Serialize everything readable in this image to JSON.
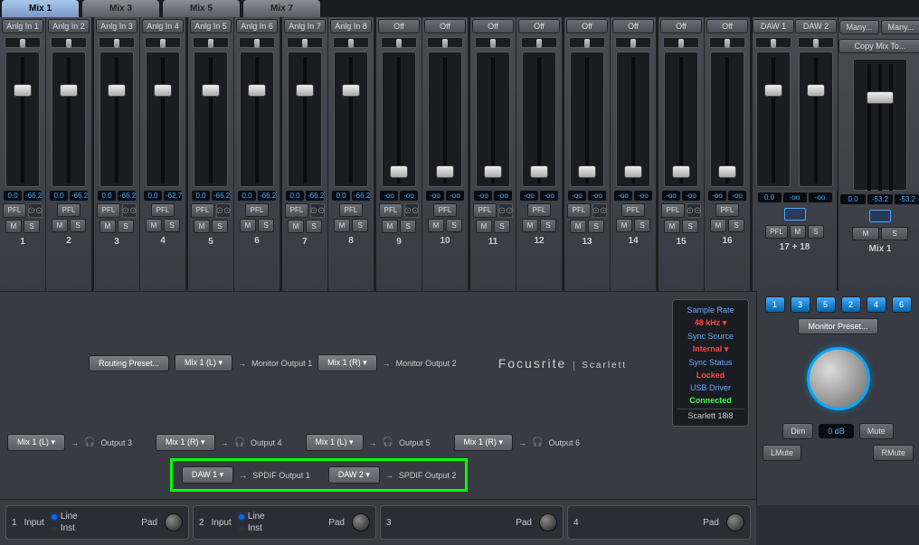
{
  "tabs": [
    "Mix 1",
    "Mix 3",
    "Mix 5",
    "Mix 7"
  ],
  "active_tab": 0,
  "channels": [
    {
      "label": "Anlg In 1",
      "v1": "0.0",
      "v2": "-66.2",
      "fader": 35,
      "num": "1"
    },
    {
      "label": "Anlg In 2",
      "v1": "0.0",
      "v2": "-66.2",
      "fader": 35,
      "num": "2"
    },
    {
      "label": "Anlg In 3",
      "v1": "0.0",
      "v2": "-66.2",
      "fader": 35,
      "num": "3"
    },
    {
      "label": "Anlg In 4",
      "v1": "0.0",
      "v2": "-62.7",
      "fader": 35,
      "num": "4"
    },
    {
      "label": "Anlg In 5",
      "v1": "0.0",
      "v2": "-66.2",
      "fader": 35,
      "num": "5"
    },
    {
      "label": "Anlg In 6",
      "v1": "0.0",
      "v2": "-66.2",
      "fader": 35,
      "num": "6"
    },
    {
      "label": "Anlg In 7",
      "v1": "0.0",
      "v2": "-66.2",
      "fader": 35,
      "num": "7"
    },
    {
      "label": "Anlg In 8",
      "v1": "0.0",
      "v2": "-66.2",
      "fader": 35,
      "num": "8"
    },
    {
      "label": "Off",
      "v1": "-oo",
      "v2": "-oo",
      "fader": 125,
      "num": "9"
    },
    {
      "label": "Off",
      "v1": "-oo",
      "v2": "-oo",
      "fader": 125,
      "num": "10"
    },
    {
      "label": "Off",
      "v1": "-oo",
      "v2": "-oo",
      "fader": 125,
      "num": "11"
    },
    {
      "label": "Off",
      "v1": "-oo",
      "v2": "-oo",
      "fader": 125,
      "num": "12"
    },
    {
      "label": "Off",
      "v1": "-oo",
      "v2": "-oo",
      "fader": 125,
      "num": "13"
    },
    {
      "label": "Off",
      "v1": "-oo",
      "v2": "-oo",
      "fader": 125,
      "num": "14"
    },
    {
      "label": "Off",
      "v1": "-oo",
      "v2": "-oo",
      "fader": 125,
      "num": "15"
    },
    {
      "label": "Off",
      "v1": "-oo",
      "v2": "-oo",
      "fader": 125,
      "num": "16"
    }
  ],
  "daw": [
    {
      "label": "DAW 1",
      "v1": "0.0",
      "v2": "-oo",
      "v3": "-oo",
      "fader": 35
    },
    {
      "label": "DAW 2",
      "v1": "0.0",
      "v2": "-oo",
      "v3": "-oo",
      "fader": 35
    }
  ],
  "daw_num": "17 + 18",
  "mix_out": {
    "lbl1": "Many...",
    "lbl2": "Many...",
    "copy": "Copy Mix To...",
    "v1": "0.0",
    "v2": "-53.2",
    "v3": "-53.2",
    "fader": 35,
    "num": "Mix 1"
  },
  "btn_pfl": "PFL",
  "btn_m": "M",
  "btn_s": "S",
  "routing": {
    "preset": "Routing Preset...",
    "rows": [
      [
        {
          "btn": "Mix 1 (L)",
          "out": "Monitor Output 1"
        },
        {
          "btn": "Mix 1 (R)",
          "out": "Monitor Output 2"
        }
      ],
      [
        {
          "btn": "Mix 1 (L)",
          "out": "Output 3",
          "hp": true
        },
        {
          "btn": "Mix 1 (R)",
          "out": "Output 4",
          "hp": true
        },
        {
          "btn": "Mix 1 (L)",
          "out": "Output 5",
          "hp": true
        },
        {
          "btn": "Mix 1 (R)",
          "out": "Output 6",
          "hp": true
        }
      ],
      [
        {
          "btn": "DAW 1",
          "out": "SPDIF Output 1"
        },
        {
          "btn": "DAW 2",
          "out": "SPDIF Output 2"
        }
      ]
    ]
  },
  "brand": {
    "a": "Focusrite",
    "b": "Scarlett"
  },
  "status": {
    "sr_lbl": "Sample Rate",
    "sr_val": "48 kHz",
    "ss_lbl": "Sync Source",
    "ss_val": "Internal",
    "st_lbl": "Sync Status",
    "st_val": "Locked",
    "usb_lbl": "USB  Driver",
    "usb_val": "Connected",
    "device": "Scarlett 18i8"
  },
  "inputs": [
    {
      "n": "1",
      "input": "Input",
      "line": "Line",
      "inst": "Inst",
      "pad": "Pad",
      "full": true
    },
    {
      "n": "2",
      "input": "Input",
      "line": "Line",
      "inst": "Inst",
      "pad": "Pad",
      "full": true
    },
    {
      "n": "3",
      "pad": "Pad"
    },
    {
      "n": "4",
      "pad": "Pad"
    }
  ],
  "monitor": {
    "presets": [
      "1",
      "3",
      "5",
      "2",
      "4",
      "6"
    ],
    "preset_btn": "Monitor Preset...",
    "dim": "Dim",
    "db": "0 dB",
    "mute": "Mute",
    "lmute": "LMute",
    "rmute": "RMute"
  }
}
